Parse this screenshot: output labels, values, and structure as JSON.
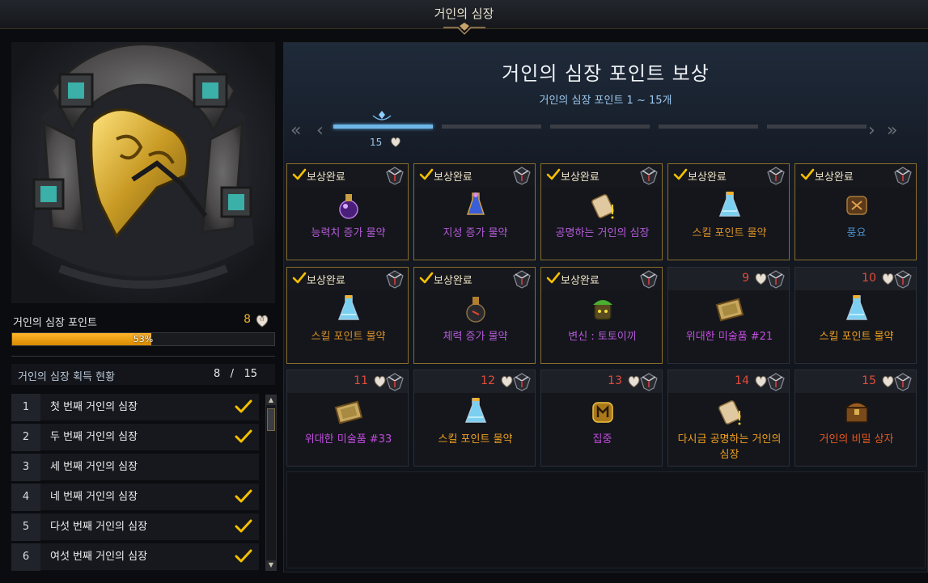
{
  "window": {
    "title": "거인의 심장"
  },
  "left": {
    "points_label": "거인의 심장 포인트",
    "points_value": "8",
    "progress_text": "53%",
    "progress": 0.53,
    "acquisition_label": "거인의 심장 획득 현황",
    "acquisition_count": "8   /   15",
    "list": [
      {
        "num": "1",
        "name": "첫 번째 거인의 심장",
        "checked": true
      },
      {
        "num": "2",
        "name": "두 번째 거인의 심장",
        "checked": true
      },
      {
        "num": "3",
        "name": "세 번째 거인의 심장",
        "checked": false
      },
      {
        "num": "4",
        "name": "네 번째 거인의 심장",
        "checked": true
      },
      {
        "num": "5",
        "name": "다섯 번째 거인의 심장",
        "checked": true
      },
      {
        "num": "6",
        "name": "여섯 번째 거인의 심장",
        "checked": true
      }
    ]
  },
  "right": {
    "title": "거인의 심장 포인트 보상",
    "subtitle": "거인의 심장 포인트 1 ~ 15개",
    "progress_label": "15",
    "rewards": [
      {
        "status": "보상완료",
        "name": "능력치 증가 물약",
        "icon": "potion-purple-icon",
        "done": true,
        "color": "#b45ad8"
      },
      {
        "status": "보상완료",
        "name": "지성 증가 물약",
        "icon": "potion-blue-flask-icon",
        "done": true,
        "color": "#b45ad8"
      },
      {
        "status": "보상완료",
        "name": "공명하는 거인의 심장",
        "icon": "scroll-icon",
        "done": true,
        "color": "#b45ad8"
      },
      {
        "status": "보상완료",
        "name": "스킬 포인트 물약",
        "icon": "potion-blue-icon",
        "done": true,
        "color": "#d8902a"
      },
      {
        "status": "보상완료",
        "name": "풍요",
        "icon": "rune-icon",
        "done": true,
        "color": "#4a8ec8"
      },
      {
        "status": "보상완료",
        "name": "스킬 포인트 물약",
        "icon": "potion-blue-icon",
        "done": true,
        "color": "#d8902a"
      },
      {
        "status": "보상완료",
        "name": "체력 증가 물약",
        "icon": "potion-dark-icon",
        "done": true,
        "color": "#b45ad8"
      },
      {
        "status": "보상완료",
        "name": "변신 : 토토이끼",
        "icon": "totoike-icon",
        "done": true,
        "color": "#b45ad8"
      },
      {
        "num": "9",
        "name": "위대한 미술품 #21",
        "icon": "painting-icon",
        "done": false,
        "color": "#c44ce0"
      },
      {
        "num": "10",
        "name": "스킬 포인트 물약",
        "icon": "potion-blue-icon",
        "done": false,
        "color": "#f0a020"
      },
      {
        "num": "11",
        "name": "위대한 미술품 #33",
        "icon": "painting-icon",
        "done": false,
        "color": "#c44ce0"
      },
      {
        "num": "12",
        "name": "스킬 포인트 물약",
        "icon": "potion-blue-icon",
        "done": false,
        "color": "#f0a020"
      },
      {
        "num": "13",
        "name": "집중",
        "icon": "rune-gold-icon",
        "done": false,
        "color": "#c44ce0"
      },
      {
        "num": "14",
        "name": "다시금 공명하는 거인의 심장",
        "icon": "scroll-icon",
        "done": false,
        "color": "#f0a020"
      },
      {
        "num": "15",
        "name": "거인의 비밀 상자",
        "icon": "chest-icon",
        "done": false,
        "color": "#e85a20"
      }
    ]
  }
}
